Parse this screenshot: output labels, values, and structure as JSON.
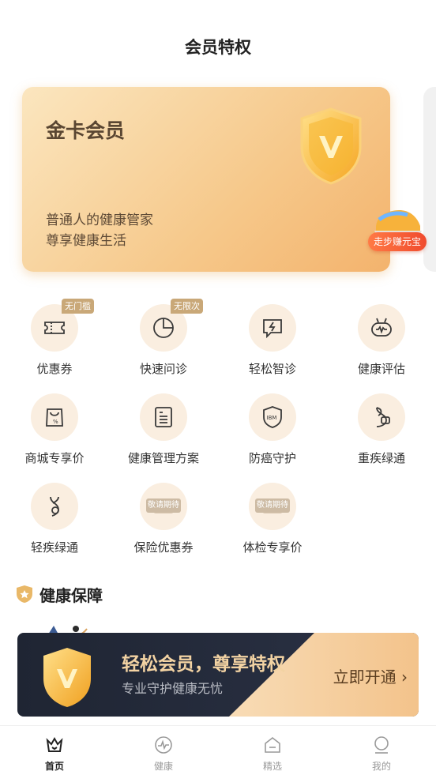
{
  "header": {
    "title": "会员特权"
  },
  "card": {
    "title": "金卡会员",
    "line1": "普通人的健康管家",
    "line2": "尊享健康生活"
  },
  "promo": {
    "label": "走步赚元宝"
  },
  "benefits": [
    {
      "label": "优惠券",
      "tag": "无门槛",
      "icon": "ticket-icon"
    },
    {
      "label": "快速问诊",
      "tag": "无限次",
      "icon": "clock-icon"
    },
    {
      "label": "轻松智诊",
      "tag": "",
      "icon": "chat-lightning-icon"
    },
    {
      "label": "健康评估",
      "tag": "",
      "icon": "robot-icon"
    },
    {
      "label": "商城专享价",
      "tag": "",
      "icon": "shopping-bag-icon"
    },
    {
      "label": "健康管理方案",
      "tag": "",
      "icon": "document-icon"
    },
    {
      "label": "防癌守护",
      "tag": "",
      "icon": "ibm-shield-icon"
    },
    {
      "label": "重疾绿通",
      "tag": "",
      "icon": "dna-chat-icon"
    },
    {
      "label": "轻疾绿通",
      "tag": "",
      "icon": "dna-icon"
    },
    {
      "label": "保险优惠券",
      "tag": "",
      "soon": "敬请期待",
      "icon": "coupon-icon"
    },
    {
      "label": "体检专享价",
      "tag": "",
      "soon": "敬请期待",
      "icon": "checkup-icon"
    }
  ],
  "section": {
    "title": "健康保障"
  },
  "banner": {
    "title": "轻松会员，尊享特权",
    "subtitle": "专业守护健康无忧",
    "cta": "立即开通",
    "cta_arrow": "›"
  },
  "tabbar": [
    {
      "label": "首页",
      "icon": "home-crown-icon",
      "active": true
    },
    {
      "label": "健康",
      "icon": "pulse-icon",
      "active": false
    },
    {
      "label": "精选",
      "icon": "selection-icon",
      "active": false
    },
    {
      "label": "我的",
      "icon": "user-icon",
      "active": false
    }
  ],
  "colors": {
    "gold": "#c9a878",
    "card_start": "#fbe6bf",
    "card_end": "#f3b36d",
    "banner_dark": "#1f2533",
    "promo_red": "#f04b2e"
  }
}
